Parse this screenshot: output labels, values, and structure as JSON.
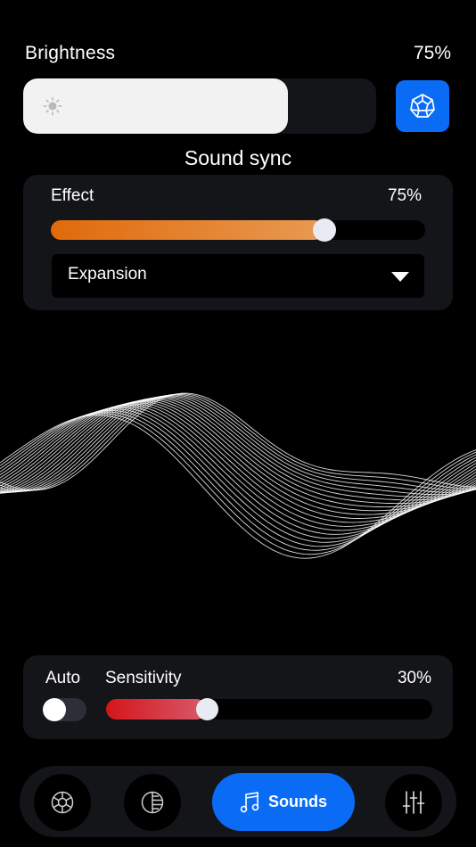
{
  "brightness": {
    "label": "Brightness",
    "value_text": "75%",
    "level": 0.75
  },
  "icons": {
    "brightness": "sun-icon",
    "scene_button": "dodecahedron-icon",
    "nav_1": "color-wheel-icon",
    "nav_2": "lines-circle-icon",
    "nav_3": "music-note-icon",
    "nav_4": "sliders-icon"
  },
  "sound_sync": {
    "title": "Sound sync",
    "effect_label": "Effect",
    "effect_value_text": "75%",
    "effect_level": 0.73,
    "effect_selected": "Expansion"
  },
  "sensitivity": {
    "auto_label": "Auto",
    "auto_on": false,
    "label": "Sensitivity",
    "value_text": "30%",
    "level": 0.31
  },
  "nav": {
    "active_label": "Sounds"
  },
  "colors": {
    "accent_blue": "#0a6cf5",
    "effect_start": "#e06a0b",
    "effect_end": "#e89a52",
    "sensitivity_start": "#d4151b",
    "sensitivity_end": "#d85a6b",
    "card_bg": "#141519"
  }
}
